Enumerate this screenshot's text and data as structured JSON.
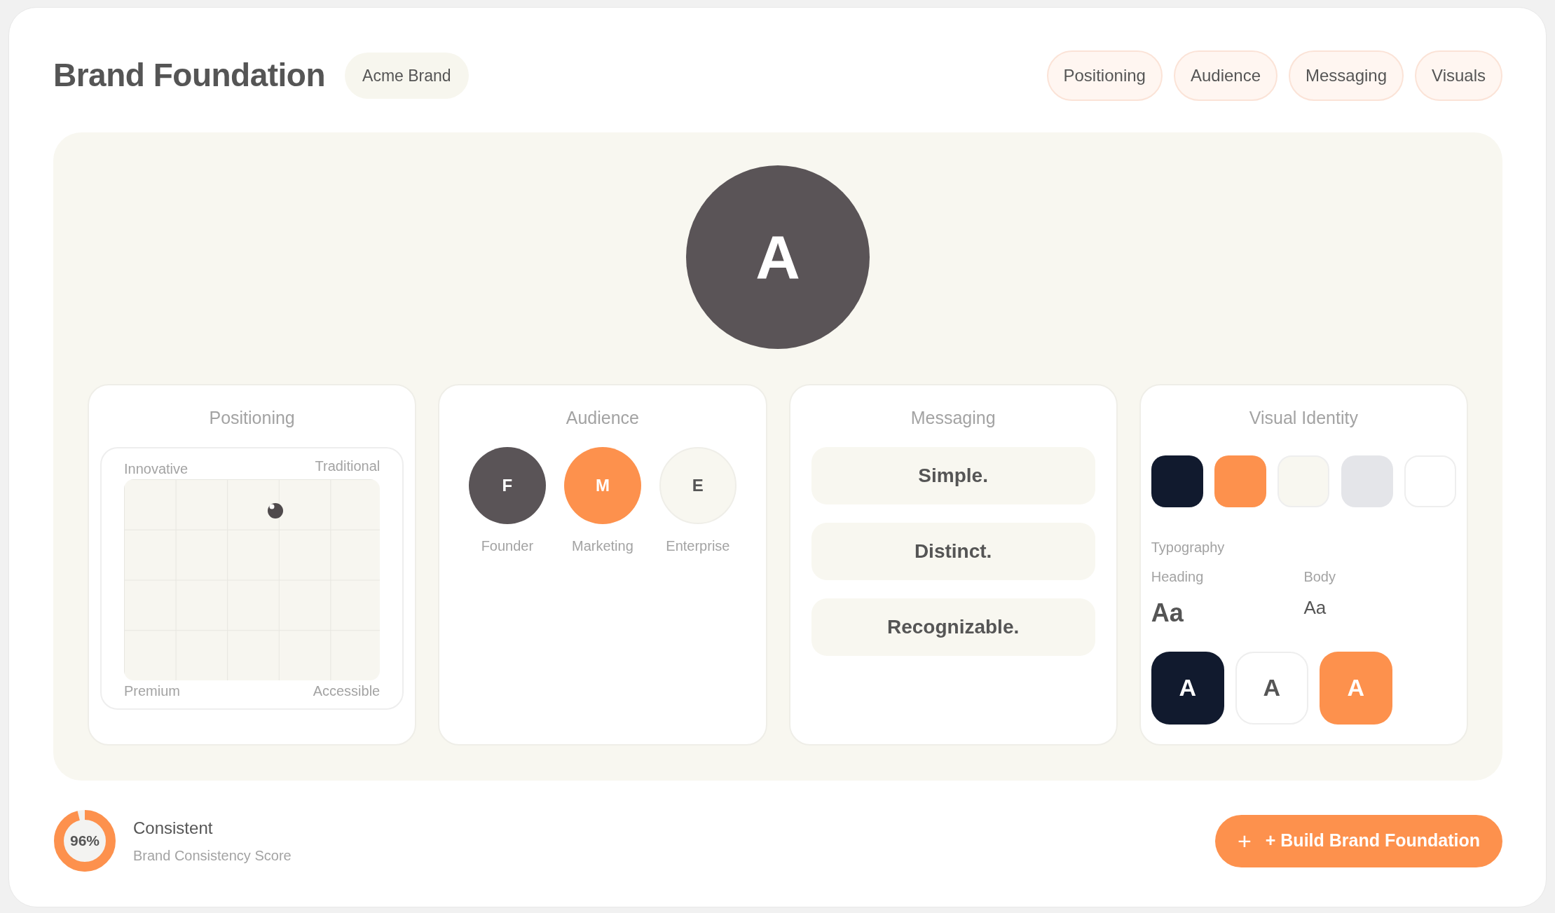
{
  "header": {
    "title": "Brand Foundation",
    "brand_tag": "Acme Brand",
    "tabs": [
      {
        "label": "Positioning",
        "selected": false
      },
      {
        "label": "Audience",
        "selected": false
      },
      {
        "label": "Messaging",
        "selected": false
      },
      {
        "label": "Visuals",
        "selected": false
      }
    ]
  },
  "logo": {
    "letter": "A"
  },
  "positioning": {
    "title": "Positioning",
    "top_left": "Innovative",
    "top_right": "Traditional",
    "bottom_left": "Premium",
    "bottom_right": "Accessible"
  },
  "audience": {
    "title": "Audience",
    "segments": [
      {
        "initial": "F",
        "label": "Founder",
        "color": "#5a5457"
      },
      {
        "initial": "M",
        "label": "Marketing",
        "color": "#fd914d"
      },
      {
        "initial": "E",
        "label": "Enterprise",
        "color": "#f8f7f0"
      }
    ]
  },
  "messaging": {
    "title": "Messaging",
    "pillars": [
      "Simple.",
      "Distinct.",
      "Recognizable."
    ]
  },
  "visual_identity": {
    "title": "Visual Identity",
    "swatches": [
      {
        "color": "#111a2e"
      },
      {
        "color": "#fd914d"
      },
      {
        "color": "#f8f7f0"
      },
      {
        "color": "#e4e5e9"
      },
      {
        "color": "#ffffff"
      }
    ],
    "typography_label": "Typography",
    "fonts": [
      {
        "kind": "heading",
        "label": "Heading",
        "sample": "Aa"
      },
      {
        "kind": "body",
        "label": "Body",
        "sample": "Aa"
      }
    ],
    "logo_variants": [
      {
        "letter": "A",
        "color": "#111a2e"
      },
      {
        "letter": "A",
        "color": "#ffffff"
      },
      {
        "letter": "A",
        "color": "#fd914d"
      }
    ]
  },
  "score": {
    "value": "96%",
    "level": 0.96,
    "status": "Consistent",
    "caption": "Brand Consistency Score"
  },
  "action_button": {
    "icon": "+",
    "label": "+ Build Brand Foundation"
  }
}
